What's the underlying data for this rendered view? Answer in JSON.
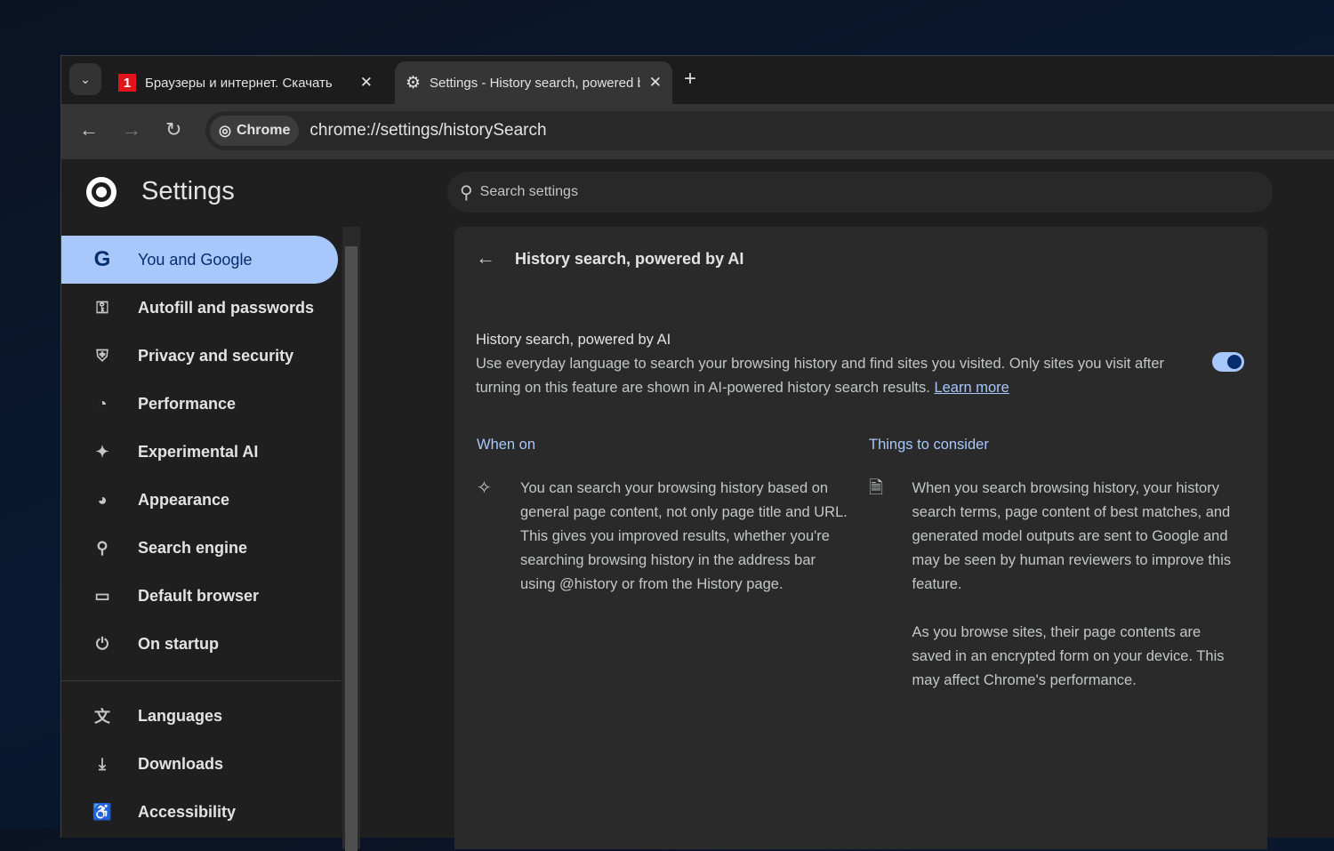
{
  "tabs": [
    {
      "title": "Браузеры и интернет. Скачать",
      "favicon": "1",
      "active": false
    },
    {
      "title": "Settings - History search, powered by AI",
      "active": true
    }
  ],
  "toolbar": {
    "chip": "Chrome",
    "url": "chrome://settings/historySearch"
  },
  "header": {
    "title": "Settings",
    "search_placeholder": "Search settings"
  },
  "sidebar": {
    "items": [
      {
        "label": "You and Google",
        "icon": "google-icon"
      },
      {
        "label": "Autofill and passwords",
        "icon": "key-icon"
      },
      {
        "label": "Privacy and security",
        "icon": "shield-icon"
      },
      {
        "label": "Performance",
        "icon": "gauge-icon"
      },
      {
        "label": "Experimental AI",
        "icon": "sparkle-icon"
      },
      {
        "label": "Appearance",
        "icon": "palette-icon"
      },
      {
        "label": "Search engine",
        "icon": "search-icon"
      },
      {
        "label": "Default browser",
        "icon": "browser-icon"
      },
      {
        "label": "On startup",
        "icon": "power-icon"
      },
      {
        "label": "Languages",
        "icon": "translate-icon"
      },
      {
        "label": "Downloads",
        "icon": "download-icon"
      },
      {
        "label": "Accessibility",
        "icon": "accessibility-icon"
      }
    ]
  },
  "page": {
    "title": "History search, powered by AI",
    "feature_title": "History search, powered by AI",
    "feature_desc": "Use everyday language to search your browsing history and find sites you visited. Only sites you visit after turning on this feature are shown in AI-powered history search results.",
    "learn_more": "Learn more",
    "toggle_on": true,
    "when_on": {
      "heading": "When on",
      "text": "You can search your browsing history based on general page content, not only page title and URL. This gives you improved results, whether you're searching browsing history in the address bar using @history or from the History page."
    },
    "consider": {
      "heading": "Things to consider",
      "text1": "When you search browsing history, your history search terms, page content of best matches, and generated model outputs are sent to Google and may be seen by human reviewers to improve this feature.",
      "text2": "As you browse sites, their page contents are saved in an encrypted form on your device. This may affect Chrome's performance."
    }
  },
  "colors": {
    "accent": "#a8c7fa",
    "accent_dark": "#062e6f"
  }
}
